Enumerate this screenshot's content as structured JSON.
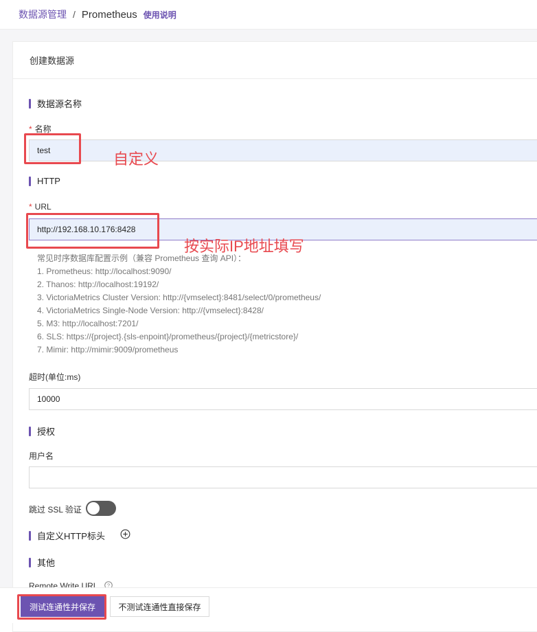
{
  "breadcrumb": {
    "parent": "数据源管理",
    "separator": "/",
    "current": "Prometheus",
    "help_link": "使用说明"
  },
  "card": {
    "title": "创建数据源"
  },
  "sections": {
    "name": "数据源名称",
    "http": "HTTP",
    "auth": "授权",
    "headers": "自定义HTTP标头",
    "other": "其他"
  },
  "fields": {
    "name": {
      "required_mark": "*",
      "label": "名称",
      "value": "test"
    },
    "url": {
      "required_mark": "*",
      "label": "URL",
      "value": "http://192.168.10.176:8428"
    },
    "timeout": {
      "label": "超时(单位:ms)",
      "value": "10000"
    },
    "username": {
      "label": "用户名",
      "value": ""
    },
    "skip_ssl": {
      "label": "跳过 SSL 验证",
      "enabled": false
    },
    "remote_write": {
      "label": "Remote Write URL"
    }
  },
  "url_hints": [
    "常见时序数据库配置示例（兼容 Prometheus 查询 API）：",
    "1. Prometheus: http://localhost:9090/",
    "2. Thanos: http://localhost:19192/",
    "3. VictoriaMetrics Cluster Version: http://{vmselect}:8481/select/0/prometheus/",
    "4. VictoriaMetrics Single-Node Version: http://{vmselect}:8428/",
    "5. M3: http://localhost:7201/",
    "6. SLS: https://{project}.{sls-enpoint}/prometheus/{project}/{metricstore}/",
    "7. Mimir: http://mimir:9009/prometheus"
  ],
  "annotations": {
    "name_note": "自定义",
    "url_note": "按实际IP地址填写"
  },
  "buttons": {
    "test_and_save": "测试连通性并保存",
    "save_without_test": "不测试连通性直接保存"
  },
  "icons": {
    "add_header": "plus-circle-icon",
    "remote_write_help": "question-circle-icon"
  },
  "colors": {
    "accent": "#6c53b1",
    "annotation": "#e8494f",
    "required": "#e03a3a"
  }
}
